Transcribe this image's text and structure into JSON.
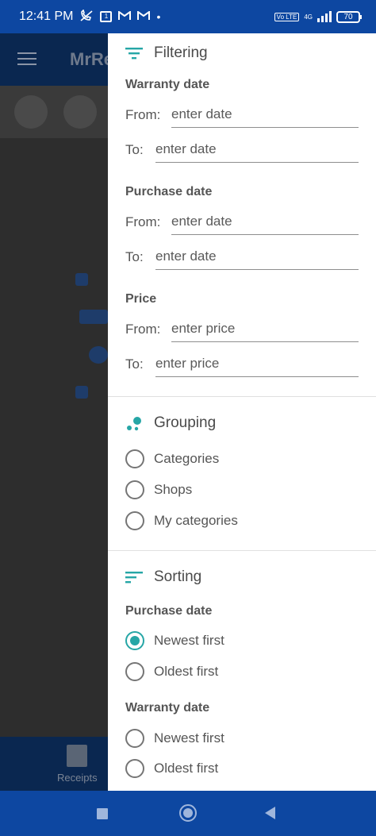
{
  "status_bar": {
    "time": "12:41 PM",
    "icons": [
      "muted-call-icon",
      "notification-box-icon",
      "gmail-icon",
      "gmail-icon",
      "dot-icon"
    ],
    "volte": "Vo LTE",
    "network": "4G",
    "battery": "70"
  },
  "app": {
    "title": "MrRe",
    "bottom_nav_label": "Receipts"
  },
  "drawer": {
    "filtering": {
      "title": "Filtering",
      "warranty": {
        "label": "Warranty date",
        "from_label": "From:",
        "from_placeholder": "enter date",
        "to_label": "To:",
        "to_placeholder": "enter date"
      },
      "purchase": {
        "label": "Purchase date",
        "from_label": "From:",
        "from_placeholder": "enter date",
        "to_label": "To:",
        "to_placeholder": "enter date"
      },
      "price": {
        "label": "Price",
        "from_label": "From:",
        "from_placeholder": "enter price",
        "to_label": "To:",
        "to_placeholder": "enter price"
      }
    },
    "grouping": {
      "title": "Grouping",
      "options": [
        "Categories",
        "Shops",
        "My categories"
      ]
    },
    "sorting": {
      "title": "Sorting",
      "purchase": {
        "label": "Purchase date",
        "options": [
          "Newest first",
          "Oldest first"
        ],
        "selected": "Newest first"
      },
      "warranty": {
        "label": "Warranty date",
        "options": [
          "Newest first",
          "Oldest first"
        ]
      }
    }
  },
  "colors": {
    "accent": "#26a6a6",
    "status_bar": "#0d47a1",
    "scrim": "#2d2d2d"
  }
}
